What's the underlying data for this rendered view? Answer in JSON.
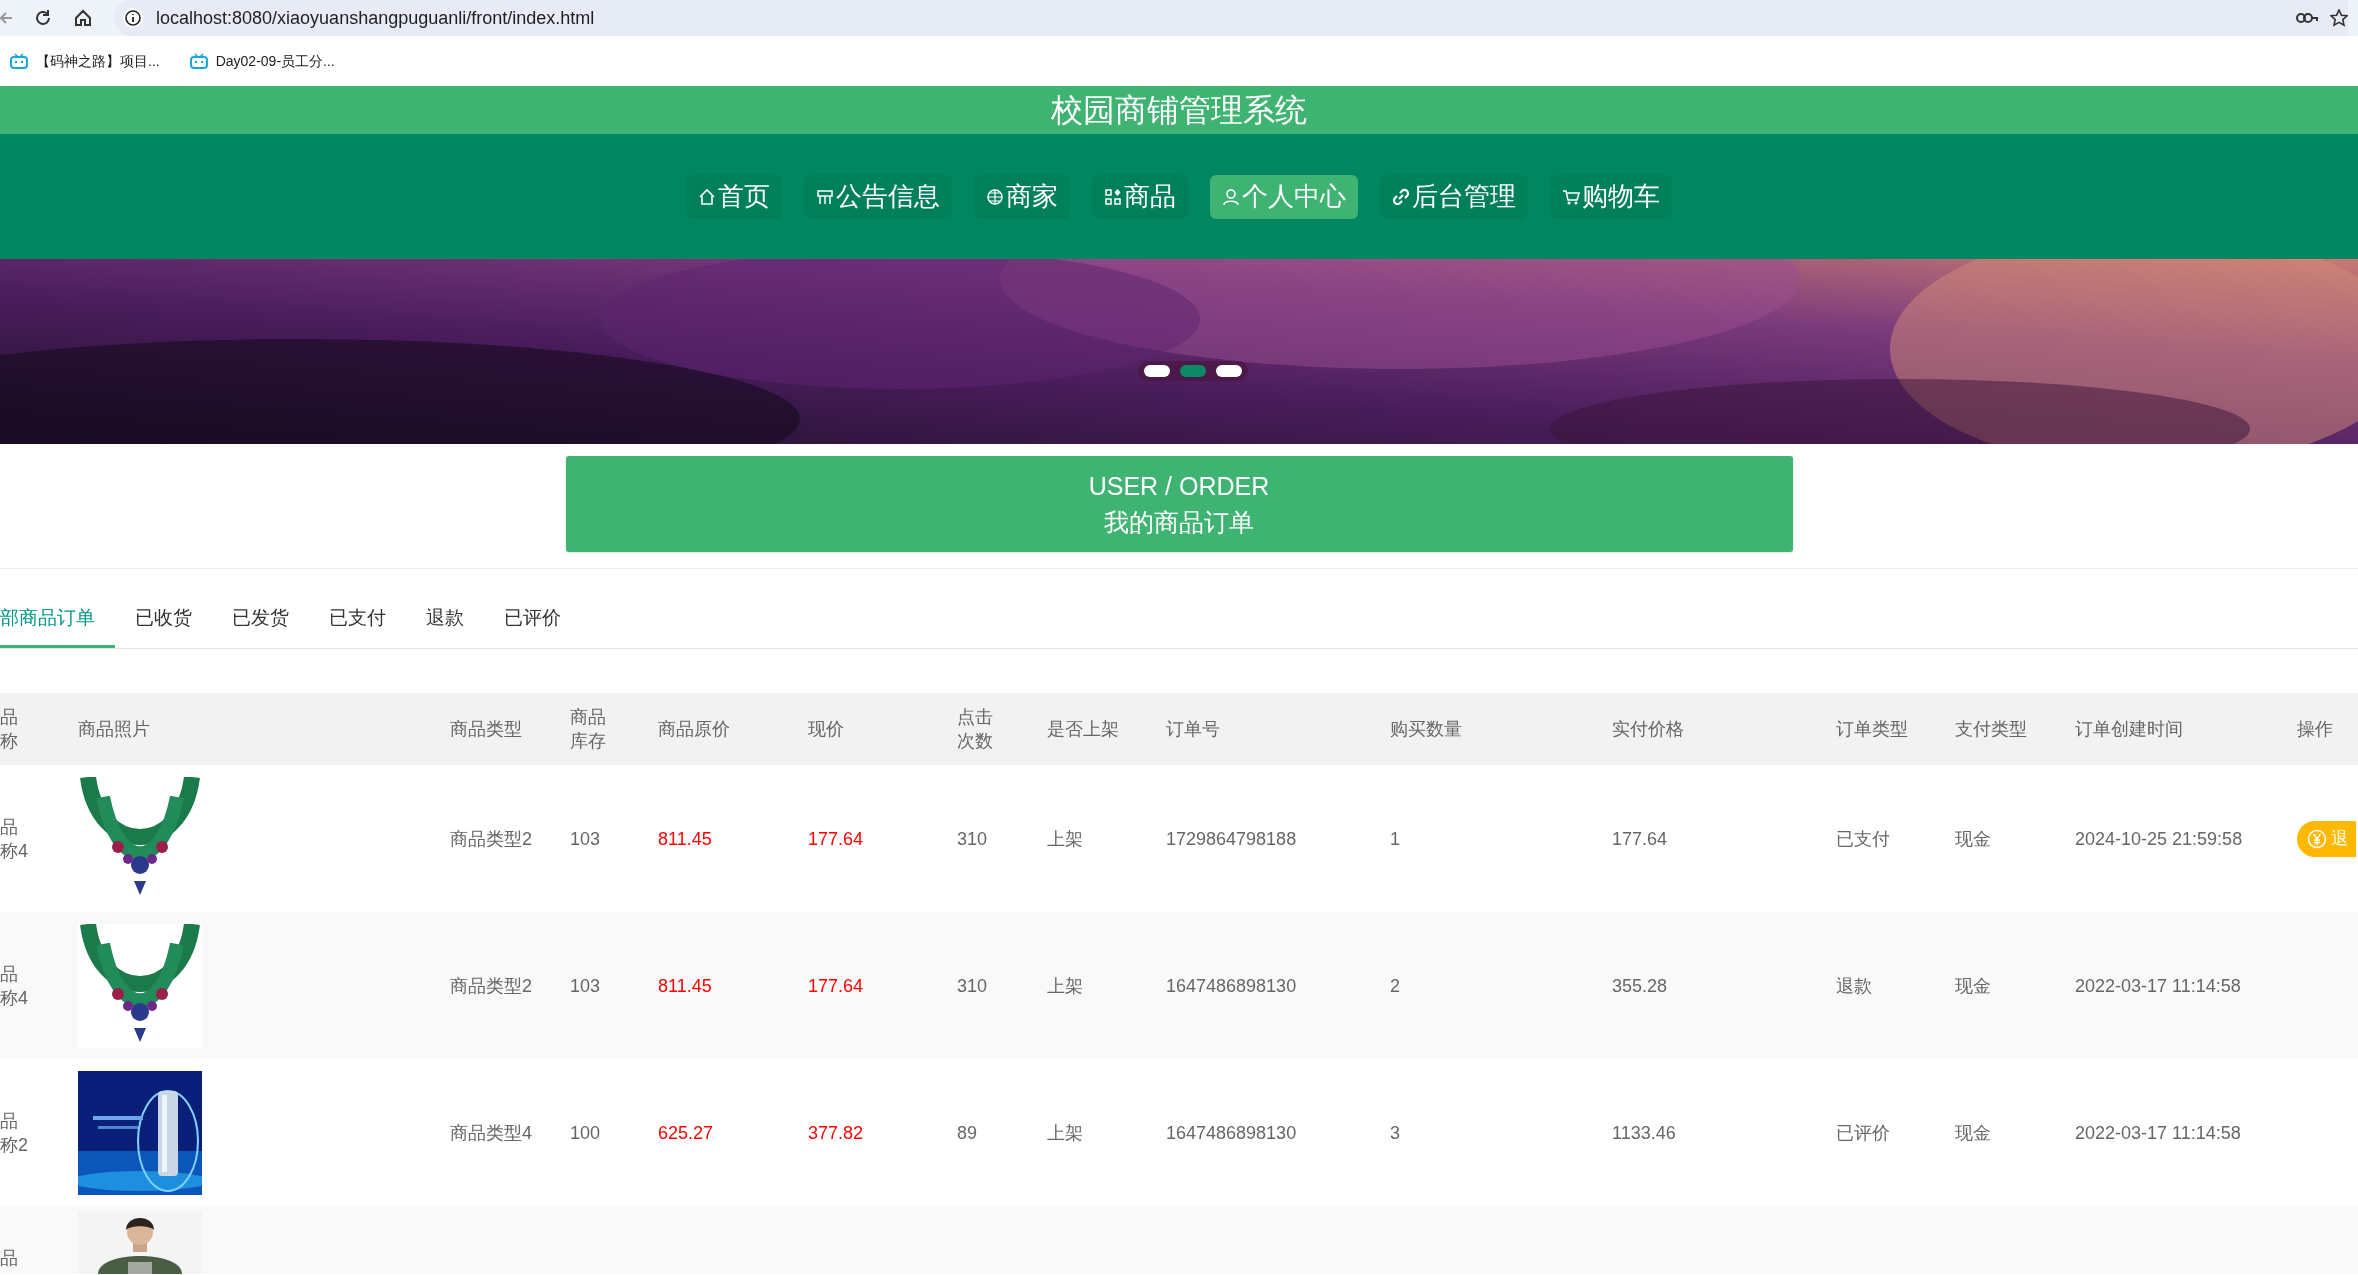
{
  "browser": {
    "url": "localhost:8080/xiaoyuanshangpuguanli/front/index.html",
    "bookmarks": [
      {
        "label": "【码神之路】项目..."
      },
      {
        "label": "Day02-09-员工分..."
      }
    ]
  },
  "site_title": "校园商铺管理系统",
  "nav": [
    {
      "label": "首页",
      "selected": false
    },
    {
      "label": "公告信息",
      "selected": false
    },
    {
      "label": "商家",
      "selected": false
    },
    {
      "label": "商品",
      "selected": false
    },
    {
      "label": "个人中心",
      "selected": true
    },
    {
      "label": "后台管理",
      "selected": false
    },
    {
      "label": "购物车",
      "selected": false
    }
  ],
  "banner": {
    "dots": [
      {
        "selected": false
      },
      {
        "selected": true
      },
      {
        "selected": false
      }
    ]
  },
  "heading": {
    "en": "USER / ORDER",
    "zh": "我的商品订单"
  },
  "tabs": [
    {
      "label": "部商品订单",
      "selected": true
    },
    {
      "label": "已收货",
      "selected": false
    },
    {
      "label": "已发货",
      "selected": false
    },
    {
      "label": "已支付",
      "selected": false
    },
    {
      "label": "退款",
      "selected": false
    },
    {
      "label": "已评价",
      "selected": false
    }
  ],
  "table": {
    "columns": [
      "品称",
      "商品照片",
      "商品类型",
      "商品库存",
      "商品原价",
      "现价",
      "点击次数",
      "是否上架",
      "订单号",
      "购买数量",
      "实付价格",
      "订单类型",
      "支付类型",
      "订单创建时间",
      "操作"
    ],
    "rows": [
      {
        "name": "品称4",
        "type": "商品类型2",
        "stock": "103",
        "original_price": "811.45",
        "price": "177.64",
        "clicks": "310",
        "listed": "上架",
        "order_no": "1729864798188",
        "quantity": "1",
        "paid": "177.64",
        "order_type": "已支付",
        "pay_type": "现金",
        "created": "2024-10-25 21:59:58",
        "action": "退"
      },
      {
        "name": "品称4",
        "type": "商品类型2",
        "stock": "103",
        "original_price": "811.45",
        "price": "177.64",
        "clicks": "310",
        "listed": "上架",
        "order_no": "1647486898130",
        "quantity": "2",
        "paid": "355.28",
        "order_type": "退款",
        "pay_type": "现金",
        "created": "2022-03-17 11:14:58"
      },
      {
        "name": "品称2",
        "type": "商品类型4",
        "stock": "100",
        "original_price": "625.27",
        "price": "377.82",
        "clicks": "89",
        "listed": "上架",
        "order_no": "1647486898130",
        "quantity": "3",
        "paid": "1133.46",
        "order_type": "已评价",
        "pay_type": "现金",
        "created": "2022-03-17 11:14:58"
      },
      {
        "name": "品"
      }
    ]
  }
}
